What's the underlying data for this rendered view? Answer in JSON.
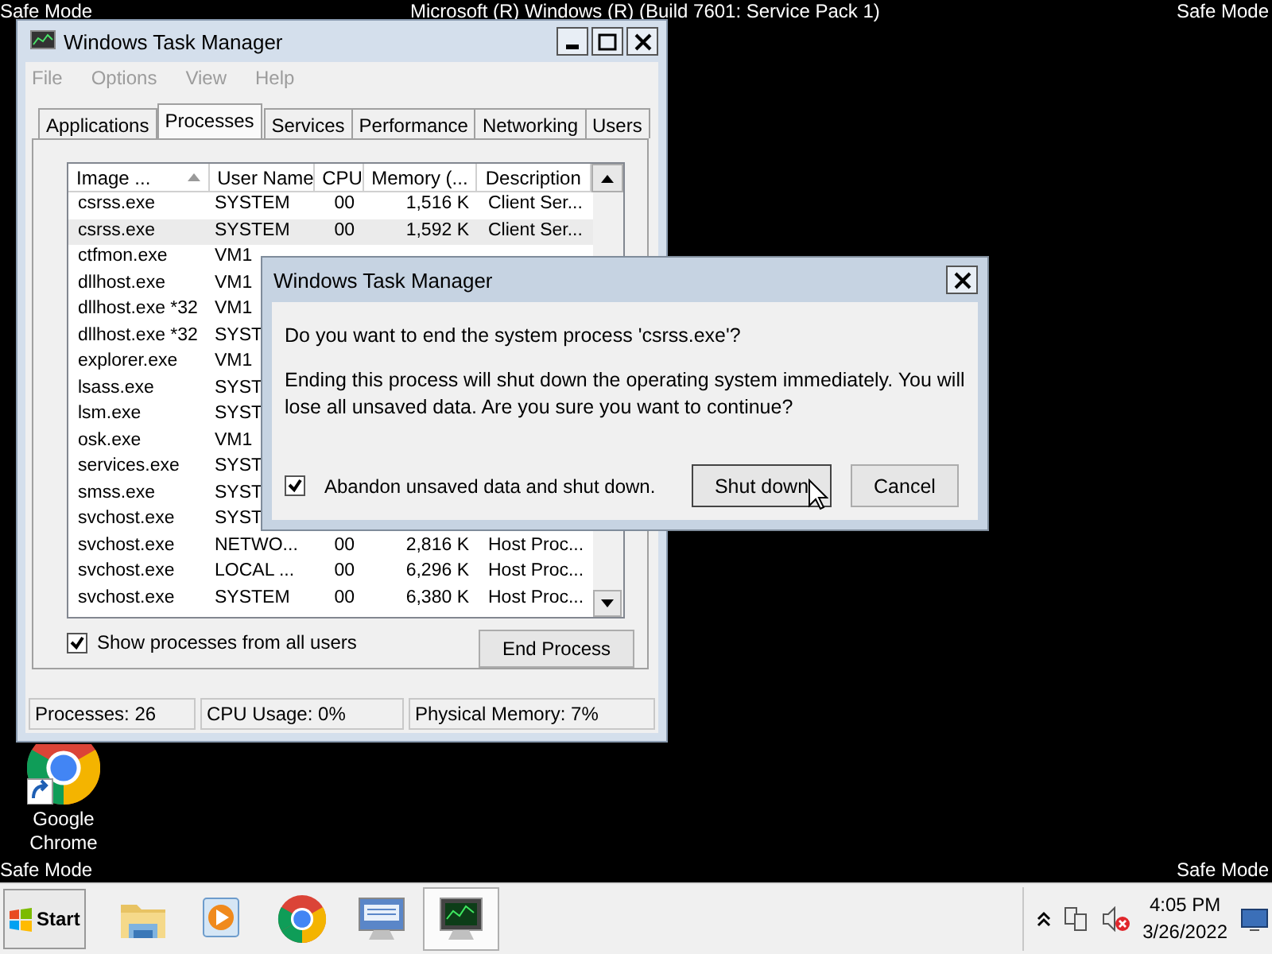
{
  "desktop": {
    "safe_mode_labels": [
      "Safe Mode",
      "Safe Mode",
      "Safe Mode",
      "Safe Mode"
    ],
    "build_text": "Microsoft (R) Windows (R) (Build 7601: Service Pack 1)",
    "icons": [
      {
        "kind": "chrome",
        "label": "Google Chrome"
      }
    ]
  },
  "task_manager": {
    "title": "Windows Task Manager",
    "menu": [
      {
        "label": "File",
        "disabled": true
      },
      {
        "label": "Options",
        "disabled": true
      },
      {
        "label": "View",
        "disabled": true
      },
      {
        "label": "Help",
        "disabled": true
      }
    ],
    "tabs": [
      {
        "label": "Applications",
        "selected": false
      },
      {
        "label": "Processes",
        "selected": true
      },
      {
        "label": "Services",
        "selected": false
      },
      {
        "label": "Performance",
        "selected": false
      },
      {
        "label": "Networking",
        "selected": false
      },
      {
        "label": "Users",
        "selected": false
      }
    ],
    "table": {
      "columns": [
        {
          "label": "Image ...",
          "sorted": true
        },
        {
          "label": "User Name",
          "sorted": false
        },
        {
          "label": "CPU",
          "sorted": false
        },
        {
          "label": "Memory (...",
          "sorted": false
        },
        {
          "label": "Description",
          "sorted": false
        }
      ],
      "rows": [
        {
          "cells": [
            "csrss.exe",
            "SYSTEM",
            "00",
            "1,516 K",
            "Client Ser..."
          ],
          "selected": false
        },
        {
          "cells": [
            "csrss.exe",
            "SYSTEM",
            "00",
            "1,592 K",
            "Client Ser..."
          ],
          "selected": true
        },
        {
          "cells": [
            "ctfmon.exe",
            "VM1"
          ],
          "selected": false
        },
        {
          "cells": [
            "dllhost.exe",
            "VM1"
          ],
          "selected": false
        },
        {
          "cells": [
            "dllhost.exe *32",
            "VM1"
          ],
          "selected": false
        },
        {
          "cells": [
            "dllhost.exe *32",
            "SYST"
          ],
          "selected": false
        },
        {
          "cells": [
            "explorer.exe",
            "VM1"
          ],
          "selected": false
        },
        {
          "cells": [
            "lsass.exe",
            "SYST"
          ],
          "selected": false
        },
        {
          "cells": [
            "lsm.exe",
            "SYST"
          ],
          "selected": false
        },
        {
          "cells": [
            "osk.exe",
            "VM1"
          ],
          "selected": false
        },
        {
          "cells": [
            "services.exe",
            "SYST"
          ],
          "selected": false
        },
        {
          "cells": [
            "smss.exe",
            "SYST"
          ],
          "selected": false
        },
        {
          "cells": [
            "svchost.exe",
            "SYST"
          ],
          "selected": false
        },
        {
          "cells": [
            "svchost.exe",
            "NETWO...",
            "00",
            "2,816 K",
            "Host Proc..."
          ],
          "selected": false
        },
        {
          "cells": [
            "svchost.exe",
            "LOCAL ...",
            "00",
            "6,296 K",
            "Host Proc..."
          ],
          "selected": false
        },
        {
          "cells": [
            "svchost.exe",
            "SYSTEM",
            "00",
            "6,380 K",
            "Host Proc..."
          ],
          "selected": false
        }
      ]
    },
    "show_all": {
      "label": "Show processes from all users",
      "checked": true
    },
    "end_button": "End Process",
    "status": [
      "Processes: 26",
      "CPU Usage: 0%",
      "Physical Memory: 7%"
    ]
  },
  "dialog": {
    "title": "Windows Task Manager",
    "question": "Do you want to end the system process 'csrss.exe'?",
    "warning": "Ending this process will shut down the operating system immediately.  You will lose all unsaved data.  Are you sure you want to continue?",
    "checkbox": {
      "label": "Abandon unsaved data and shut down.",
      "checked": true
    },
    "buttons": [
      {
        "label": "Shut down",
        "focused": true
      },
      {
        "label": "Cancel",
        "focused": false
      }
    ]
  },
  "taskbar": {
    "start": "Start",
    "apps": [
      {
        "kind": "folder",
        "active": false
      },
      {
        "kind": "player",
        "active": false
      },
      {
        "kind": "chrome",
        "active": false
      },
      {
        "kind": "keyboard",
        "active": false
      },
      {
        "kind": "taskmgr",
        "active": true
      }
    ],
    "time": "4:05 PM",
    "date": "3/26/2022"
  }
}
